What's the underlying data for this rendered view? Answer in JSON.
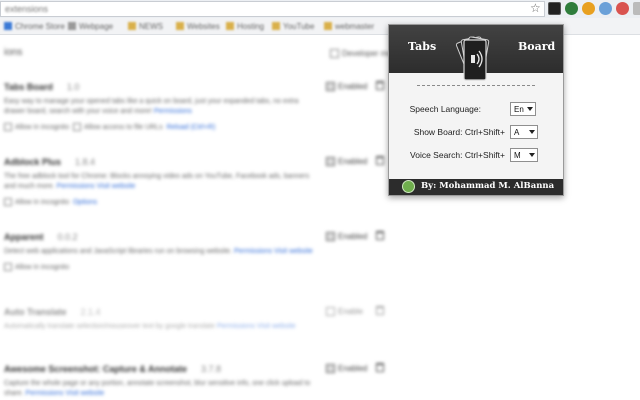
{
  "browser": {
    "url_text": "extensions",
    "bookmarks": [
      "Chrome Store",
      "Webpage",
      "NEWS",
      "Websites",
      "Hosting",
      "YouTube",
      "webmaster"
    ]
  },
  "page": {
    "heading": "ions",
    "developer_mode_label": "Developer mode",
    "extensions": [
      {
        "name": "Tabs Board",
        "version": "1.0",
        "description": "Easy way to manage your opened tabs like a quick on board, just your expanded tabs, no extra drawer board, search with your voice and more!",
        "link": "Permissions",
        "options": [
          "Allow in incognito",
          "Allow access to file URLs"
        ],
        "options_link": "Reload (Ctrl+R)",
        "status": "Enabled"
      },
      {
        "name": "Adblock Plus",
        "version": "1.8.4",
        "description": "The free adblock tool for Chrome: Blocks annoying video ads on YouTube, Facebook ads, banners and much more.",
        "link": "Permissions",
        "link2": "Visit website",
        "options": [
          "Allow in incognito"
        ],
        "options_link": "Options",
        "status": "Enabled"
      },
      {
        "name": "Apparent",
        "version": "0.0.2",
        "description": "Detect web applications and JavaScript libraries run on browsing website.",
        "link": "Permissions",
        "link2": "Visit website",
        "options": [
          "Allow in incognito"
        ],
        "status": "Enabled"
      },
      {
        "name": "Auto Translate",
        "version": "2.1.4",
        "description": "Automatically translate selection/mouseover text by google translate",
        "link": "Permissions",
        "link2": "Visit website",
        "options": [],
        "status": "Enable"
      },
      {
        "name": "Awesome Screenshot: Capture & Annotate",
        "version": "3.7.8",
        "description": "Capture the whole page or any portion, annotate screenshot, blur sensitive info, one click upload to share.",
        "link": "Permissions",
        "link2": "Visit website",
        "options": [],
        "status": "Enabled"
      }
    ]
  },
  "popup": {
    "header_left": "Tabs",
    "header_right": "Board",
    "speech_language_label": "Speech Language:",
    "speech_language_value": "En",
    "show_board_label": "Show Board: Ctrl+Shift+",
    "show_board_value": "A",
    "voice_search_label": "Voice Search: Ctrl+Shift+",
    "voice_search_value": "M",
    "footer_text": "By: Mohammad M. AlBanna",
    "colors": {
      "header": "#333333",
      "footer": "#2c2c2c",
      "body": "#f4f4f4",
      "footer_icon": "#6fae4d"
    }
  }
}
